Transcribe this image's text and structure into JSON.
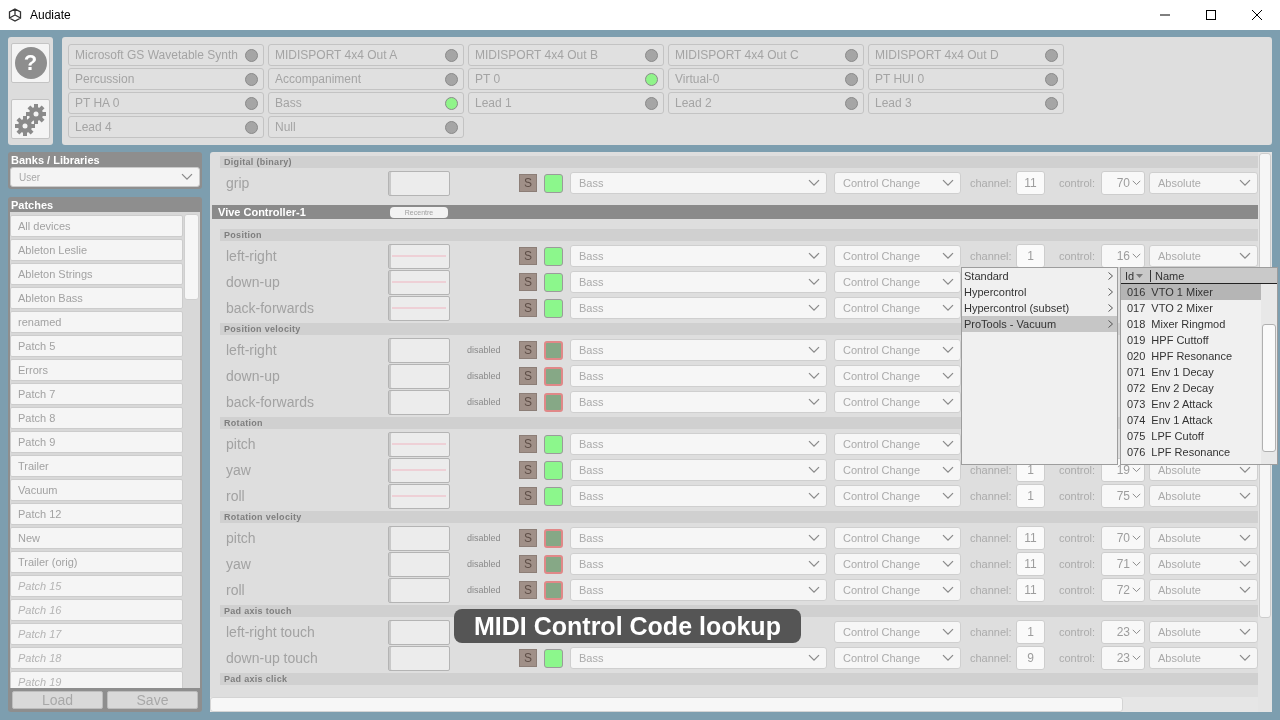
{
  "window": {
    "title": "Audiate"
  },
  "toolbar": [
    {
      "kind": "help",
      "label": "?"
    },
    {
      "kind": "settings"
    }
  ],
  "devices": [
    {
      "name": "Microsoft GS Wavetable Synth",
      "active": false
    },
    {
      "name": "MIDISPORT 4x4 Out A",
      "active": false
    },
    {
      "name": "MIDISPORT 4x4 Out B",
      "active": false
    },
    {
      "name": "MIDISPORT 4x4 Out C",
      "active": false
    },
    {
      "name": "MIDISPORT 4x4 Out D",
      "active": false
    },
    {
      "name": "Percussion",
      "active": false
    },
    {
      "name": "Accompaniment",
      "active": false
    },
    {
      "name": "PT 0",
      "active": true
    },
    {
      "name": "Virtual-0",
      "active": false
    },
    {
      "name": "PT HUI 0",
      "active": false
    },
    {
      "name": "PT HA 0",
      "active": false
    },
    {
      "name": "Bass",
      "active": true
    },
    {
      "name": "Lead 1",
      "active": false
    },
    {
      "name": "Lead 2",
      "active": false
    },
    {
      "name": "Lead 3",
      "active": false
    },
    {
      "name": "Lead 4",
      "active": false
    },
    {
      "name": "Null",
      "active": false
    }
  ],
  "banks": {
    "title": "Banks / Libraries",
    "value": "User"
  },
  "patches": {
    "title": "Patches",
    "items": [
      {
        "name": "All devices",
        "empty": false
      },
      {
        "name": "Ableton Leslie",
        "empty": false
      },
      {
        "name": "Ableton Strings",
        "empty": false
      },
      {
        "name": "Ableton Bass",
        "empty": false
      },
      {
        "name": "renamed",
        "empty": false
      },
      {
        "name": "Patch 5",
        "empty": false
      },
      {
        "name": "Errors",
        "empty": false
      },
      {
        "name": "Patch 7",
        "empty": false
      },
      {
        "name": "Patch 8",
        "empty": false
      },
      {
        "name": "Patch 9",
        "empty": false
      },
      {
        "name": "Trailer",
        "empty": false
      },
      {
        "name": "Vacuum",
        "empty": false
      },
      {
        "name": "Patch 12",
        "empty": false
      },
      {
        "name": "New",
        "empty": false
      },
      {
        "name": "Trailer (orig)",
        "empty": false
      },
      {
        "name": "Patch 15",
        "empty": true
      },
      {
        "name": "Patch 16",
        "empty": true
      },
      {
        "name": "Patch 17",
        "empty": true
      },
      {
        "name": "Patch 18",
        "empty": true
      },
      {
        "name": "Patch 19",
        "empty": true
      }
    ],
    "buttons": [
      "Load",
      "Save"
    ]
  },
  "mapping": [
    {
      "kind": "group",
      "title": "Digital (binary)",
      "rows": [
        {
          "label": "grip",
          "trace": false,
          "solo": "S",
          "enabled": true,
          "target": "Bass",
          "message": "Control Change",
          "channel_label": "channel:",
          "channel": "11",
          "control_label": "control:",
          "control": "70",
          "mode": "Absolute"
        }
      ]
    },
    {
      "kind": "device",
      "title": "Vive Controller-1",
      "button": "Recentre"
    },
    {
      "kind": "group",
      "title": "Position",
      "rows": [
        {
          "label": "left-right",
          "trace": true,
          "solo": "S",
          "enabled": true,
          "target": "Bass",
          "message": "Control Change",
          "channel_label": "channel:",
          "channel": "1",
          "control_label": "control:",
          "control": "16",
          "mode": "Absolute"
        },
        {
          "label": "down-up",
          "trace": true,
          "solo": "S",
          "enabled": true,
          "target": "Bass",
          "message": "Control Change"
        },
        {
          "label": "back-forwards",
          "trace": true,
          "solo": "S",
          "enabled": true,
          "target": "Bass",
          "message": "Control Change"
        }
      ]
    },
    {
      "kind": "group",
      "title": "Position velocity",
      "rows": [
        {
          "label": "left-right",
          "trace": false,
          "status": "disabled",
          "solo": "S",
          "enabled": false,
          "target": "Bass",
          "message": "Control Change"
        },
        {
          "label": "down-up",
          "trace": false,
          "status": "disabled",
          "solo": "S",
          "enabled": false,
          "target": "Bass",
          "message": "Control Change"
        },
        {
          "label": "back-forwards",
          "trace": false,
          "status": "disabled",
          "solo": "S",
          "enabled": false,
          "target": "Bass",
          "message": "Control Change"
        }
      ]
    },
    {
      "kind": "group",
      "title": "Rotation",
      "rows": [
        {
          "label": "pitch",
          "trace": true,
          "solo": "S",
          "enabled": true,
          "target": "Bass",
          "message": "Control Change"
        },
        {
          "label": "yaw",
          "trace": true,
          "solo": "S",
          "enabled": true,
          "target": "Bass",
          "message": "Control Change",
          "channel_label": "channel:",
          "channel": "1",
          "control_label": "control:",
          "control": "19",
          "mode": "Absolute"
        },
        {
          "label": "roll",
          "trace": true,
          "solo": "S",
          "enabled": true,
          "target": "Bass",
          "message": "Control Change",
          "channel_label": "channel:",
          "channel": "1",
          "control_label": "control:",
          "control": "75",
          "mode": "Absolute"
        }
      ]
    },
    {
      "kind": "group",
      "title": "Rotation velocity",
      "rows": [
        {
          "label": "pitch",
          "trace": false,
          "status": "disabled",
          "solo": "S",
          "enabled": false,
          "target": "Bass",
          "message": "Control Change",
          "channel_label": "channel:",
          "channel": "11",
          "control_label": "control:",
          "control": "70",
          "mode": "Absolute"
        },
        {
          "label": "yaw",
          "trace": false,
          "status": "disabled",
          "solo": "S",
          "enabled": false,
          "target": "Bass",
          "message": "Control Change",
          "channel_label": "channel:",
          "channel": "11",
          "control_label": "control:",
          "control": "71",
          "mode": "Absolute"
        },
        {
          "label": "roll",
          "trace": false,
          "status": "disabled",
          "solo": "S",
          "enabled": false,
          "target": "Bass",
          "message": "Control Change",
          "channel_label": "channel:",
          "channel": "11",
          "control_label": "control:",
          "control": "72",
          "mode": "Absolute"
        }
      ]
    },
    {
      "kind": "group",
      "title": "Pad axis touch",
      "rows": [
        {
          "label": "left-right touch",
          "trace": false,
          "message": "Control Change",
          "channel_label": "channel:",
          "channel": "1",
          "control_label": "control:",
          "control": "23",
          "mode": "Absolute"
        },
        {
          "label": "down-up touch",
          "trace": false,
          "solo": "S",
          "enabled": true,
          "target": "Bass",
          "message": "Control Change",
          "channel_label": "channel:",
          "channel": "9",
          "control_label": "control:",
          "control": "23",
          "mode": "Absolute"
        }
      ]
    },
    {
      "kind": "group",
      "title": "Pad axis click"
    }
  ],
  "lookup": {
    "categories": [
      {
        "name": "Standard",
        "selected": false
      },
      {
        "name": "Hypercontrol",
        "selected": false
      },
      {
        "name": "Hypercontrol (subset)",
        "selected": false
      },
      {
        "name": "ProTools - Vacuum",
        "selected": true
      }
    ],
    "columns": [
      "Id",
      "Name"
    ],
    "codes": [
      {
        "id": "016",
        "name": "VTO 1 Mixer",
        "selected": true
      },
      {
        "id": "017",
        "name": "VTO 2 Mixer",
        "selected": false
      },
      {
        "id": "018",
        "name": "Mixer Ringmod",
        "selected": false
      },
      {
        "id": "019",
        "name": "HPF Cuttoff",
        "selected": false
      },
      {
        "id": "020",
        "name": "HPF Resonance",
        "selected": false
      },
      {
        "id": "071",
        "name": "Env 1 Decay",
        "selected": false
      },
      {
        "id": "072",
        "name": "Env 2 Decay",
        "selected": false
      },
      {
        "id": "073",
        "name": "Env 2 Attack",
        "selected": false
      },
      {
        "id": "074",
        "name": "Env 1 Attack",
        "selected": false
      },
      {
        "id": "075",
        "name": "LPF Cutoff",
        "selected": false
      },
      {
        "id": "076",
        "name": "LPF Resonance",
        "selected": false
      }
    ]
  },
  "tooltip": "MIDI Control Code lookup"
}
